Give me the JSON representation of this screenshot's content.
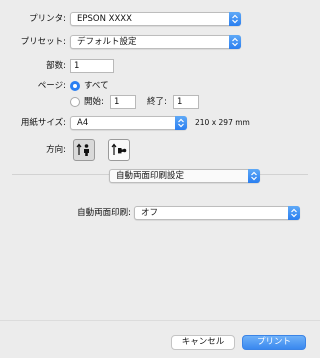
{
  "printer": {
    "label": "プリンタ:",
    "value": "EPSON XXXX"
  },
  "preset": {
    "label": "プリセット:",
    "value": "デフォルト設定"
  },
  "copies": {
    "label": "部数:",
    "value": "1"
  },
  "pages": {
    "label": "ページ:",
    "all_label": "すべて",
    "from_label": "開始:",
    "from_value": "1",
    "to_label": "終了:",
    "to_value": "1",
    "selected": "all"
  },
  "paper_size": {
    "label": "用紙サイズ:",
    "value": "A4",
    "dimensions": "210 x 297 mm"
  },
  "orientation": {
    "label": "方向:",
    "selected": "portrait"
  },
  "section": {
    "value": "自動両面印刷設定"
  },
  "duplex": {
    "label": "自動両面印刷:",
    "value": "オフ"
  },
  "buttons": {
    "cancel": "キャンセル",
    "print": "プリント"
  },
  "colors": {
    "accent": "#2b7ff2",
    "background": "#ececec"
  }
}
